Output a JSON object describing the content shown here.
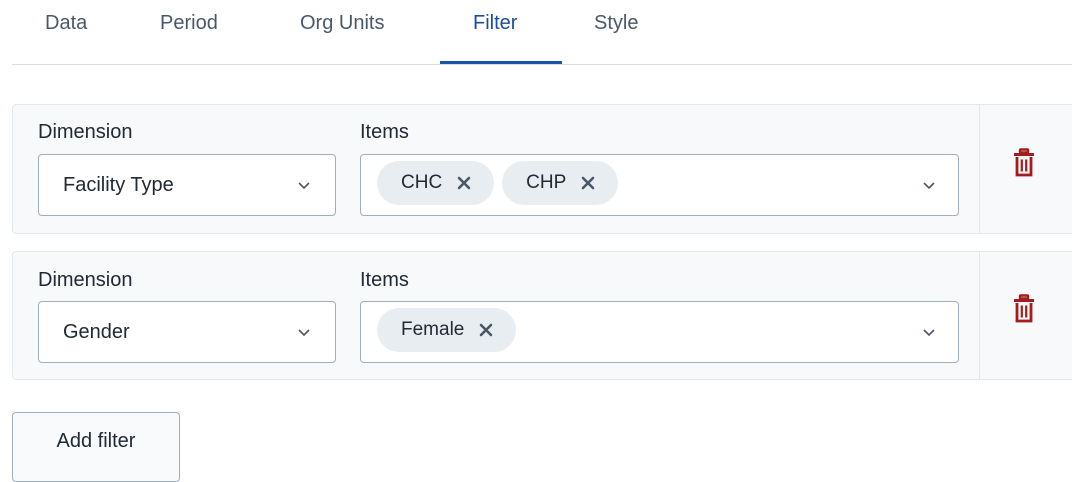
{
  "tabs": [
    {
      "label": "Data",
      "active": false
    },
    {
      "label": "Period",
      "active": false
    },
    {
      "label": "Org Units",
      "active": false
    },
    {
      "label": "Filter",
      "active": true
    },
    {
      "label": "Style",
      "active": false
    }
  ],
  "filters": [
    {
      "dimension_label": "Dimension",
      "dimension_value": "Facility Type",
      "items_label": "Items",
      "items": [
        "CHC",
        "CHP"
      ]
    },
    {
      "dimension_label": "Dimension",
      "dimension_value": "Gender",
      "items_label": "Items",
      "items": [
        "Female"
      ]
    }
  ],
  "add_filter_label": "Add filter",
  "colors": {
    "active_tab": "#1a4d9b",
    "delete_icon": "#a51c1c",
    "chip_bg": "#e8edf2"
  },
  "icons": {
    "delete": "trash-icon",
    "remove_chip": "close-icon",
    "dropdown": "chevron-down-icon"
  }
}
